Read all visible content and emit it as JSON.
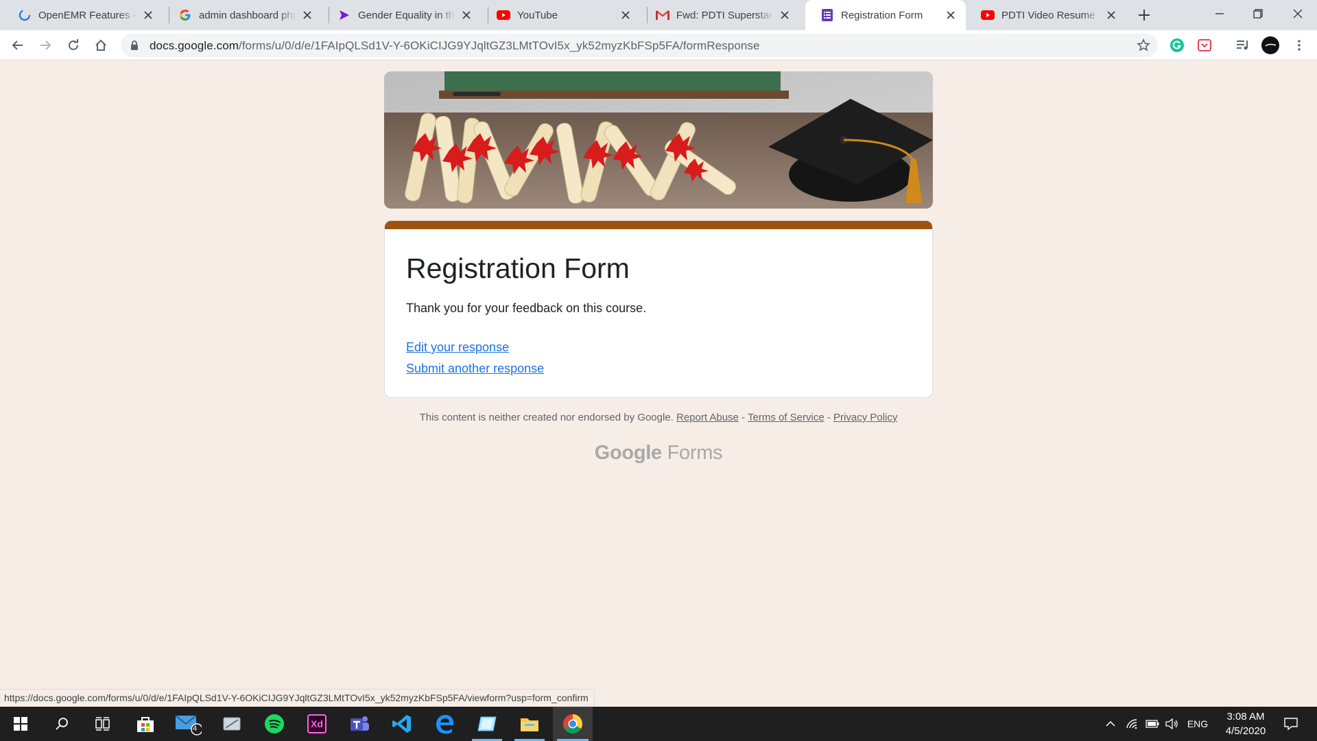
{
  "browser": {
    "tabs": [
      {
        "title": "OpenEMR Features - Op",
        "favicon": "openemr-loading-icon",
        "active": false
      },
      {
        "title": "admin dashboard php c",
        "favicon": "google-g-icon",
        "active": false
      },
      {
        "title": "Gender Equality in the",
        "favicon": "chevron-brand-icon",
        "active": false
      },
      {
        "title": "YouTube",
        "favicon": "youtube-icon",
        "active": false
      },
      {
        "title": "Fwd: PDTI Superstar Pro",
        "favicon": "gmail-icon",
        "active": false
      },
      {
        "title": "Registration Form",
        "favicon": "google-forms-icon",
        "active": true
      },
      {
        "title": "PDTI Video Resume - Yo",
        "favicon": "youtube-icon",
        "active": false
      }
    ],
    "url_domain": "docs.google.com",
    "url_path": "/forms/u/0/d/e/1FAIpQLSd1V-Y-6OKiCIJG9YJqltGZ3LMtTOvI5x_yk52myzKbFSp5FA/formResponse",
    "status_url": "https://docs.google.com/forms/u/0/d/e/1FAIpQLSd1V-Y-6OKiCIJG9YJqltGZ3LMtTOvI5x_yk52myzKbFSp5FA/viewform?usp=form_confirm"
  },
  "form": {
    "title": "Registration Form",
    "confirmation": "Thank you for your feedback on this course.",
    "edit_link": "Edit your response",
    "submit_another_link": "Submit another response",
    "accent_color": "#a0510e"
  },
  "footer": {
    "disclaimer": "This content is neither created nor endorsed by Google.",
    "report_abuse": "Report Abuse",
    "separator": "-",
    "terms": "Terms of Service",
    "privacy": "Privacy Policy",
    "brand_google": "Google",
    "brand_forms": "Forms"
  },
  "taskbar": {
    "mail_badge": "4",
    "xd_label": "Xd",
    "language": "ENG",
    "time": "3:08 AM",
    "date": "4/5/2020"
  },
  "colors": {
    "page_bg": "#f6ede7",
    "link_blue": "#1a73e8",
    "tabstrip": "#dee1e6",
    "taskbar": "#1f1f1f"
  }
}
